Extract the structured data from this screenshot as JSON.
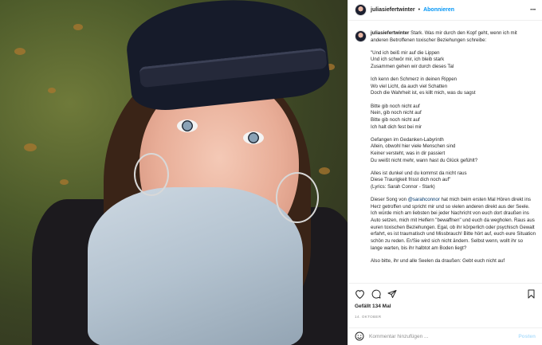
{
  "header": {
    "username": "juliasiefertwinter",
    "separator": "•",
    "follow_label": "Abonnieren",
    "more_label": "···"
  },
  "caption": {
    "username": "juliasiefertwinter",
    "intro": " Stark. Was mir durch den Kopf geht, wenn ich mit anderen Betroffenen toxischer Beziehungen schreibe:",
    "stanza1": [
      "\"Und ich beiß mir auf die Lippen",
      "Und ich schwör mir, ich bleib stark",
      "Zusammen gehen wir durch dieses Tal"
    ],
    "stanza2": [
      "Ich kenn den Schmerz in deinen Rippen",
      "Wo viel Licht, da auch viel Schatten",
      "Doch die Wahrheit ist, es killt mich, was du sagst"
    ],
    "stanza3": [
      "Bitte gib noch nicht auf",
      "Nein, gib noch nicht auf",
      "Bitte gib noch nicht auf",
      "Ich halt dich fest bei mir"
    ],
    "stanza4": [
      "Gefangen im Gedanken-Labyrinth",
      "Allein, obwohl hier viele Menschen sind",
      "Keiner versteht, was in dir passiert",
      "Du weißt nicht mehr, wann hast du Glück gefühlt?"
    ],
    "stanza5": [
      "Alles ist dunkel und du kommst da nicht raus",
      "Diese Traurigkeit frisst dich noch auf\"",
      "(Lyrics: Sarah Connor - Stark)"
    ],
    "para_pre": "Dieser Song von ",
    "mention": "@sarahconnor",
    "para_post": " hat mich beim ersten Mal Hören direkt ins Herz getroffen und spricht mir und so vielen anderen direkt aus der Seele. Ich würde mich am liebsten bei jeder Nachricht von euch dort draußen ins Auto setzen, mich mit Helfern \"bewaffnen\" und euch da wegholen. Raus aus euren toxischen Beziehungen. Egal, ob ihr körperlich oder psychisch Gewalt erfahrt, es ist traumatisch und Missbrauch! Bitte hört auf, euch eure Situation schön zu reden. Er/Sie wird sich nicht ändern. Selbst wenn, wollt ihr so lange warten, bis ihr halbtot am Boden liegt?",
    "cut_line": "Also bitte, ihr und alle Seelen da draußen: Gebt euch nicht auf"
  },
  "actions": {
    "like_icon": "heart-icon",
    "comment_icon": "comment-bubble-icon",
    "share_icon": "paper-plane-icon",
    "save_icon": "bookmark-icon"
  },
  "likes": "Gefällt 134 Mal",
  "date": "14. Oktober",
  "comment_box": {
    "emoji_icon": "smiley-icon",
    "placeholder": "Kommentar hinzufügen ...",
    "post_label": "Posten"
  },
  "colors": {
    "accent": "#0095f6",
    "mention": "#00376b",
    "muted": "#8e8e8e",
    "post_disabled": "#b2dffc"
  }
}
